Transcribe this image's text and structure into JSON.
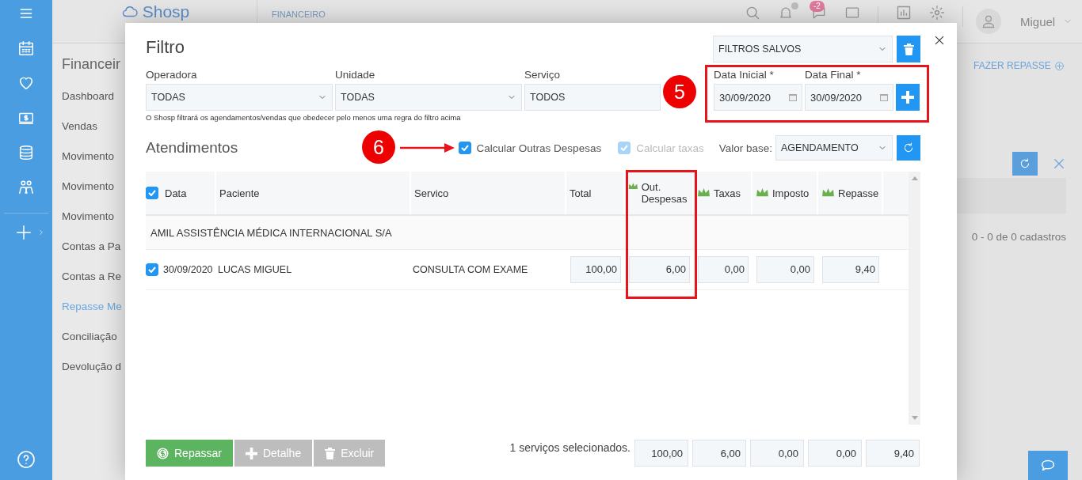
{
  "header": {
    "logo": "Shosp",
    "section": "FINANCEIRO",
    "notification_badge": "-2",
    "user": "Miguel"
  },
  "sidebar": {
    "title": "Financeir",
    "items": [
      {
        "label": "Dashboard",
        "selected": false
      },
      {
        "label": "Vendas",
        "selected": false
      },
      {
        "label": "Movimento",
        "selected": false
      },
      {
        "label": "Movimento",
        "selected": false
      },
      {
        "label": "Movimento",
        "selected": false
      },
      {
        "label": "Contas a Pa",
        "selected": false
      },
      {
        "label": "Contas a Re",
        "selected": false
      },
      {
        "label": "Repasse Me",
        "selected": true
      },
      {
        "label": "Conciliação",
        "selected": false
      },
      {
        "label": "Devolução d",
        "selected": false
      }
    ]
  },
  "right_panel": {
    "action": "FAZER REPASSE",
    "pagination": "0 - 0 de 0 cadastros"
  },
  "modal": {
    "title": "Filtro",
    "saved_filters": "FILTROS SALVOS",
    "filters": [
      {
        "label": "Operadora",
        "value": "TODAS"
      },
      {
        "label": "Unidade",
        "value": "TODAS"
      },
      {
        "label": "Serviço",
        "value": "TODOS"
      }
    ],
    "dates": [
      {
        "label": "Data Inicial *",
        "value": "30/09/2020"
      },
      {
        "label": "Data Final *",
        "value": "30/09/2020"
      }
    ],
    "hint": "O Shosp filtrará os agendamentos/vendas que obedecer pelo menos uma regra do filtro acima",
    "section": "Atendimentos",
    "options": [
      {
        "label": "Calcular Outras Despesas",
        "checked": true,
        "disabled": false
      },
      {
        "label": "Calcular taxas",
        "checked": true,
        "disabled": true
      }
    ],
    "valor_base": {
      "label": "Valor base:",
      "value": "AGENDAMENTO"
    },
    "table": {
      "select_all": true,
      "columns": [
        {
          "label": "Data",
          "kind": "text",
          "crown": false
        },
        {
          "label": "Paciente",
          "kind": "text",
          "crown": false
        },
        {
          "label": "Servico",
          "kind": "text",
          "crown": false
        },
        {
          "label": "Total",
          "kind": "amount",
          "crown": false
        },
        {
          "label": "Out. Despesas",
          "kind": "amount",
          "crown": true
        },
        {
          "label": "Taxas",
          "kind": "amount",
          "crown": true
        },
        {
          "label": "Imposto",
          "kind": "amount",
          "crown": true
        },
        {
          "label": "Repasse",
          "kind": "amount",
          "crown": true
        }
      ],
      "group": "AMIL ASSISTÊNCIA MÉDICA INTERNACIONAL S/A",
      "rows": [
        {
          "selected": true,
          "cells": [
            "30/09/2020",
            "LUCAS MIGUEL",
            "CONSULTA COM EXAME",
            "100,00",
            "6,00",
            "0,00",
            "0,00",
            "9,40"
          ]
        }
      ]
    },
    "actions": [
      {
        "label": "Repassar",
        "kind": "pay",
        "disabled": false
      },
      {
        "label": "Detalhe",
        "kind": "add",
        "disabled": true
      },
      {
        "label": "Excluir",
        "kind": "delete",
        "disabled": true
      }
    ],
    "selected_count": "1 serviços selecionados.",
    "totals": [
      "100,00",
      "6,00",
      "0,00",
      "0,00",
      "9,40"
    ]
  },
  "annotations": [
    {
      "number": "5"
    },
    {
      "number": "6"
    }
  ]
}
